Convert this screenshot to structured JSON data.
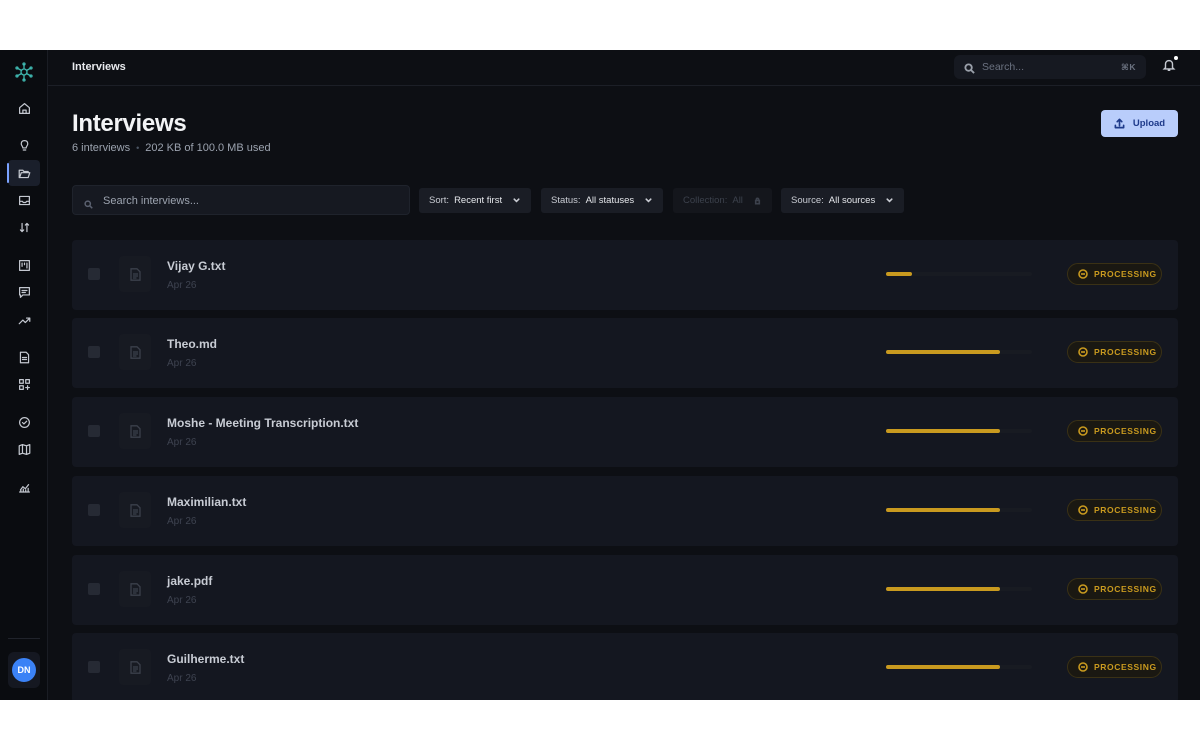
{
  "colors": {
    "accent": "#b9cdfb",
    "processing": "#c99a1f",
    "avatar": "#3b82f6",
    "background": "#0d0f14"
  },
  "topbar": {
    "breadcrumb": "Interviews",
    "search_placeholder": "Search...",
    "search_shortcut": "⌘K"
  },
  "sidebar": {
    "items": [
      {
        "icon": "home-icon"
      },
      {
        "icon": "lightbulb-icon"
      },
      {
        "icon": "folder-open-icon",
        "active": true
      },
      {
        "icon": "inbox-icon"
      },
      {
        "icon": "sort-arrows-icon"
      },
      {
        "icon": "kanban-icon"
      },
      {
        "icon": "message-icon"
      },
      {
        "icon": "trending-up-icon"
      },
      {
        "icon": "document-icon"
      },
      {
        "icon": "grid-plus-icon"
      },
      {
        "icon": "check-circle-icon"
      },
      {
        "icon": "map-icon"
      },
      {
        "icon": "stats-chart-icon"
      }
    ],
    "avatar_initials": "DN"
  },
  "header": {
    "title": "Interviews",
    "count_text": "6 interviews",
    "usage_text": "202 KB of 100.0 MB used",
    "upload_label": "Upload"
  },
  "filters": {
    "search_placeholder": "Search interviews...",
    "sort": {
      "label": "Sort:",
      "value": "Recent first"
    },
    "status": {
      "label": "Status:",
      "value": "All statuses"
    },
    "collection": {
      "label": "Collection:",
      "value": "All",
      "disabled": true
    },
    "source": {
      "label": "Source:",
      "value": "All sources"
    }
  },
  "interviews": [
    {
      "name": "Vijay G.txt",
      "date": "Apr 26",
      "status": "PROCESSING",
      "progress": 0.18
    },
    {
      "name": "Theo.md",
      "date": "Apr 26",
      "status": "PROCESSING",
      "progress": 0.78
    },
    {
      "name": "Moshe - Meeting Transcription.txt",
      "date": "Apr 26",
      "status": "PROCESSING",
      "progress": 0.78
    },
    {
      "name": "Maximilian.txt",
      "date": "Apr 26",
      "status": "PROCESSING",
      "progress": 0.78
    },
    {
      "name": "jake.pdf",
      "date": "Apr 26",
      "status": "PROCESSING",
      "progress": 0.78
    },
    {
      "name": "Guilherme.txt",
      "date": "Apr 26",
      "status": "PROCESSING",
      "progress": 0.78
    }
  ]
}
